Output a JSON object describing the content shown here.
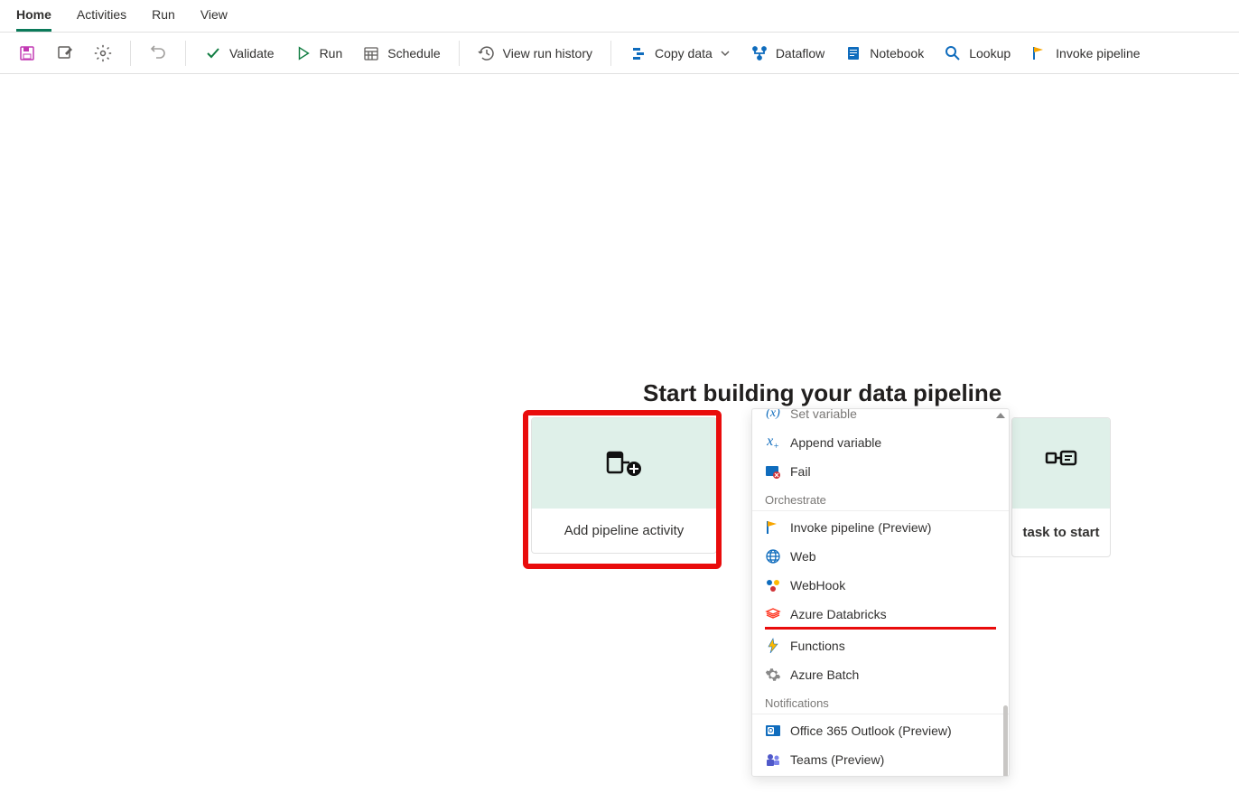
{
  "tabs": [
    "Home",
    "Activities",
    "Run",
    "View"
  ],
  "activeTab": 0,
  "toolbar": {
    "validate": "Validate",
    "run": "Run",
    "schedule": "Schedule",
    "history": "View run history",
    "copy": "Copy data",
    "dataflow": "Dataflow",
    "notebook": "Notebook",
    "lookup": "Lookup",
    "invoke": "Invoke pipeline"
  },
  "heading": "Start building your data pipeline",
  "tile": {
    "label": "Add pipeline activity"
  },
  "tile2": {
    "label": "task to start"
  },
  "dropdown": {
    "items": [
      {
        "icon": "var",
        "label": "Set variable",
        "cut": true
      },
      {
        "icon": "var-plus",
        "label": "Append variable"
      },
      {
        "icon": "fail",
        "label": "Fail"
      }
    ],
    "section1": "Orchestrate",
    "items2": [
      {
        "icon": "flag",
        "label": "Invoke pipeline (Preview)"
      },
      {
        "icon": "globe",
        "label": "Web"
      },
      {
        "icon": "webhook",
        "label": "WebHook"
      },
      {
        "icon": "databricks",
        "label": "Azure Databricks"
      },
      {
        "icon": "functions",
        "label": "Functions"
      },
      {
        "icon": "gear",
        "label": "Azure Batch"
      }
    ],
    "section2": "Notifications",
    "items3": [
      {
        "icon": "outlook",
        "label": "Office 365 Outlook (Preview)"
      },
      {
        "icon": "teams",
        "label": "Teams (Preview)"
      }
    ]
  }
}
